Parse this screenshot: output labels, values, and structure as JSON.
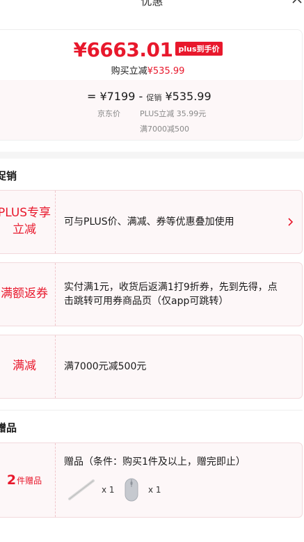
{
  "header": {
    "title": "优惠"
  },
  "price_card": {
    "final_price": "¥6663.01",
    "plus_badge": "plus到手价",
    "subtitle_prefix": "购买立减",
    "subtitle_amount": "¥535.99",
    "equals": "=",
    "jd_price": "¥7199",
    "minus": "-",
    "promo_label": "促销",
    "promo_amount": "¥535.99",
    "jd_price_label": "京东价",
    "plus_discount_label": "PLUS立减 35.99元",
    "full_reduction_label": "满7000减500"
  },
  "sections": {
    "promotion_title": "促销",
    "gift_title": "赠品"
  },
  "promotions": [
    {
      "tag": "PLUS专享立减",
      "tag_line1": "PLUS专享",
      "tag_line2": "立减",
      "desc": "可与PLUS价、满减、券等优惠叠加使用",
      "has_arrow": true
    },
    {
      "tag": "满额返券",
      "desc": "实付满1元，收货后返满1打9折券，先到先得，点击跳转可用券商品页（仅app可跳转）",
      "has_arrow": false
    },
    {
      "tag": "满减",
      "desc": "满7000元减500元",
      "has_arrow": false
    }
  ],
  "gift": {
    "count": "2",
    "count_label": "件赠品",
    "title": "赠品（条件：购买1件及以上，赠完即止）",
    "items": [
      {
        "icon": "stylus-pen-icon",
        "qty": "x 1"
      },
      {
        "icon": "mouse-icon",
        "qty": "x 1"
      }
    ]
  },
  "colors": {
    "accent": "#e8182c",
    "tag_bg": "#fdf7f8",
    "border": "#f2d9dc"
  }
}
